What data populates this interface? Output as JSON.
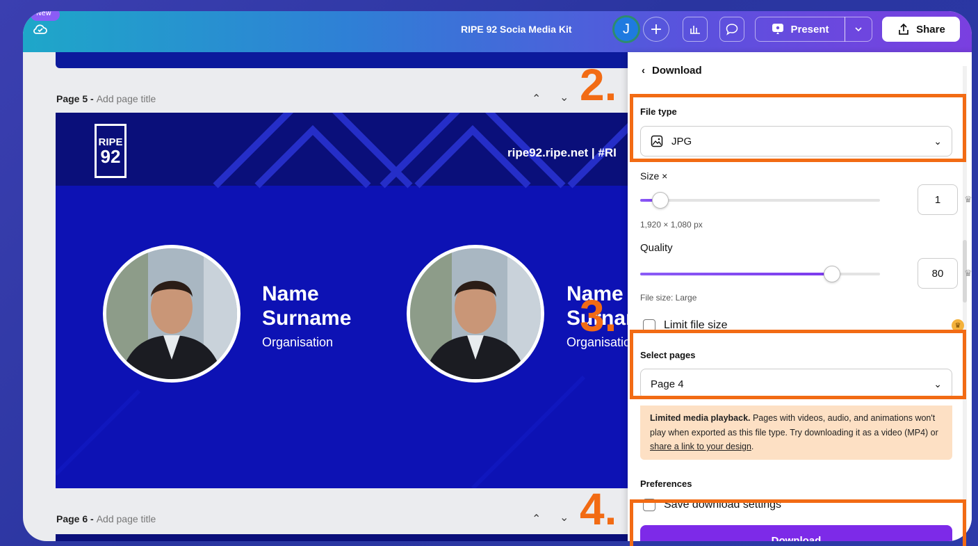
{
  "topbar": {
    "new_badge": "New",
    "doc_title": "RIPE 92 Socia Media Kit",
    "avatar_initial": "J",
    "plus_label": "+",
    "present_label": "Present",
    "share_label": "Share",
    "icons": [
      "cloud-check-icon",
      "plus-icon",
      "stats-icon",
      "comment-icon",
      "present-icon",
      "chevron-down-icon",
      "share-icon"
    ]
  },
  "canvas": {
    "page5": {
      "number_label": "Page 5 -",
      "title_placeholder": "Add page title"
    },
    "page6": {
      "number_label": "Page 6 -",
      "title_placeholder": "Add page title"
    },
    "page_controls": {
      "up": "^",
      "down": "v"
    },
    "design": {
      "logo_line1": "RIPE",
      "logo_line2": "92",
      "site_text": "ripe92.ripe.net | #RI",
      "person1": {
        "name_line1": "Name",
        "name_line2": "Surname",
        "org": "Organisation"
      },
      "person2": {
        "name_line1": "Name",
        "name_line2": "Surname",
        "org": "Organisation"
      },
      "colors": {
        "background": "#0d12b4",
        "band": "#0a0f7a",
        "text": "#ffffff"
      }
    }
  },
  "panel": {
    "back_label": "Download",
    "file_type": {
      "label": "File type",
      "value": "JPG"
    },
    "size": {
      "label": "Size ×",
      "value": "1",
      "level": 0.1,
      "dimensions": "1,920 × 1,080 px"
    },
    "quality": {
      "label": "Quality",
      "value": "80",
      "level": 0.8,
      "file_size": "File size: Large"
    },
    "limit_file_size": {
      "label": "Limit file size",
      "checked": false
    },
    "select_pages": {
      "label": "Select pages",
      "value": "Page 4"
    },
    "notice": {
      "title": "Limited media playback.",
      "text_before_link": " Pages with videos, audio, and animations won't play when exported as this file type. Try downloading it as a video (MP4) or ",
      "link": "share a link to your design",
      "text_after_link": "."
    },
    "preferences": {
      "label": "Preferences",
      "save_settings": "Save download settings",
      "checked": false
    },
    "download_button": "Download"
  },
  "annotations": {
    "step2": "2.",
    "step3": "3.",
    "step4": "4.",
    "color": "#f26b14"
  }
}
